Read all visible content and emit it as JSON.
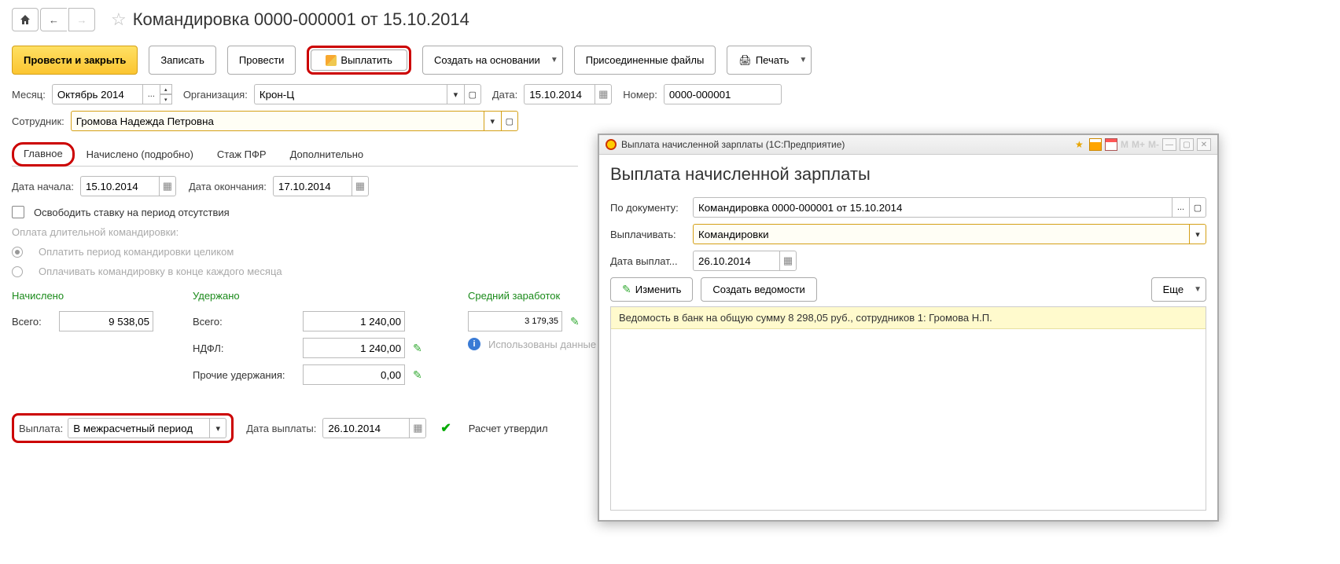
{
  "pageTitle": "Командировка 0000-000001 от 15.10.2014",
  "actions": {
    "postClose": "Провести и закрыть",
    "save": "Записать",
    "post": "Провести",
    "pay": "Выплатить",
    "createBased": "Создать на основании",
    "attachedFiles": "Присоединенные файлы",
    "print": "Печать"
  },
  "fields": {
    "monthLabel": "Месяц:",
    "monthValue": "Октябрь 2014",
    "orgLabel": "Организация:",
    "orgValue": "Крон-Ц",
    "dateLabel": "Дата:",
    "dateValue": "15.10.2014",
    "numberLabel": "Номер:",
    "numberValue": "0000-000001",
    "employeeLabel": "Сотрудник:",
    "employeeValue": "Громова Надежда Петровна"
  },
  "tabs": {
    "main": "Главное",
    "accrued": "Начислено (подробно)",
    "pfr": "Стаж ПФР",
    "extra": "Дополнительно"
  },
  "mainTab": {
    "startLabel": "Дата начала:",
    "startValue": "15.10.2014",
    "endLabel": "Дата окончания:",
    "endValue": "17.10.2014",
    "freeRate": "Освободить ставку на период отсутствия",
    "longTrip": "Оплата длительной командировки:",
    "payWhole": "Оплатить период командировки целиком",
    "payMonthly": "Оплачивать командировку в конце каждого месяца"
  },
  "calc": {
    "accruedHeader": "Начислено",
    "deductedHeader": "Удержано",
    "avgHeader": "Средний заработок",
    "totalLabel": "Всего:",
    "accruedTotal": "9 538,05",
    "deductedTotal": "1 240,00",
    "ndflLabel": "НДФЛ:",
    "ndflValue": "1 240,00",
    "otherLabel": "Прочие удержания:",
    "otherValue": "0,00",
    "avgValue": "3 179,35",
    "dataUsedNote": "Использованы данные о"
  },
  "payment": {
    "paymentLabel": "Выплата:",
    "paymentValue": "В межрасчетный период",
    "payDateLabel": "Дата выплаты:",
    "payDateValue": "26.10.2014",
    "approved": "Расчет утвердил"
  },
  "modal": {
    "windowTitle": "Выплата начисленной зарплаты  (1С:Предприятие)",
    "title": "Выплата начисленной зарплаты",
    "docLabel": "По документу:",
    "docValue": "Командировка 0000-000001 от 15.10.2014",
    "payLabel": "Выплачивать:",
    "payValue": "Командировки",
    "dateLabel": "Дата выплат...",
    "dateValue": "26.10.2014",
    "editBtn": "Изменить",
    "createSheets": "Создать ведомости",
    "moreBtn": "Еще",
    "banner": "Ведомость в банк на общую сумму 8 298,05 руб., сотрудников 1: Громова Н.П."
  }
}
